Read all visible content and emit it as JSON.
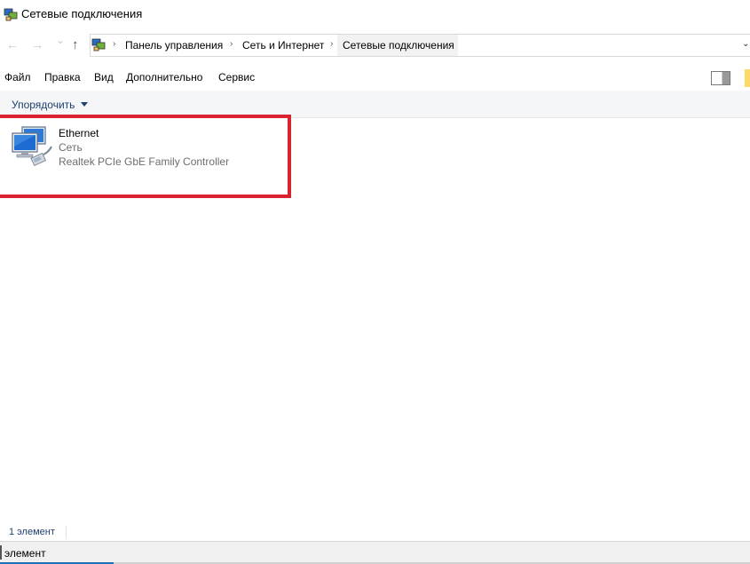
{
  "window": {
    "title": "Сетевые подключения",
    "icon": "network-connections-icon"
  },
  "navigation": {
    "back_icon": "arrow-left-icon",
    "forward_icon": "arrow-right-icon",
    "recent_icon": "chevron-down-icon",
    "up_icon": "arrow-up-icon",
    "back_glyph": "←",
    "forward_glyph": "→",
    "recent_glyph": "⌄",
    "up_glyph": "↑"
  },
  "breadcrumb": {
    "items": [
      "Панель управления",
      "Сеть и Интернет",
      "Сетевые подключения"
    ],
    "separator": "›",
    "dropdown_glyph": "⌄"
  },
  "menu": {
    "items": [
      "Файл",
      "Правка",
      "Вид",
      "Дополнительно",
      "Сервис"
    ]
  },
  "command_bar": {
    "organize_label": "Упорядочить"
  },
  "connections": [
    {
      "name": "Ethernet",
      "network": "Сеть",
      "adapter": "Realtek PCIe GbE Family Controller",
      "icon": "ethernet-adapter-icon"
    }
  ],
  "status": {
    "count": "1 элемент"
  },
  "bottom_bar": {
    "text": "элемент"
  },
  "colors": {
    "highlight": "#d9232f",
    "accent_text": "#1e3f6f"
  }
}
